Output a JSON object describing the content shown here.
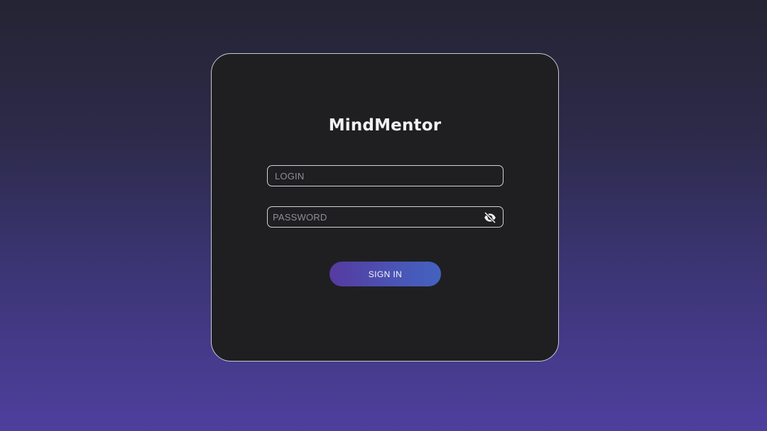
{
  "app": {
    "title": "MindMentor"
  },
  "login_form": {
    "login_placeholder": "LOGIN",
    "login_value": "",
    "password_placeholder": "PASSWORD",
    "password_value": "",
    "password_toggle_icon": "eye-off-icon",
    "submit_label": "SIGN IN"
  },
  "colors": {
    "background_top": "#252433",
    "background_bottom": "#4e3f9e",
    "card": "#1f1f22",
    "button_start": "#563aa0",
    "button_end": "#4462c0"
  }
}
